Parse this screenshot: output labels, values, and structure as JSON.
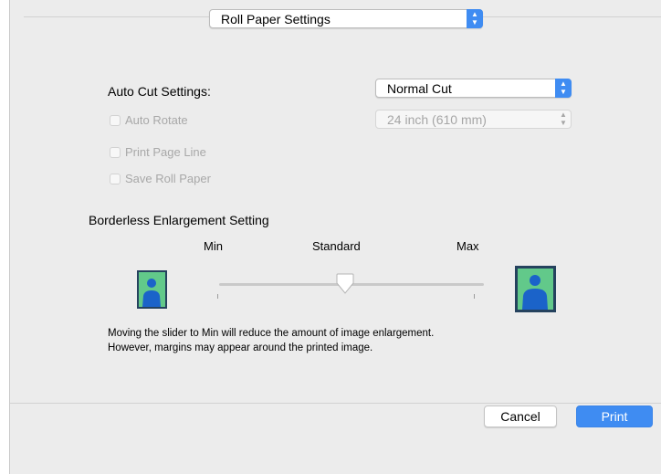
{
  "panel_select": {
    "value": "Roll Paper Settings"
  },
  "auto_cut": {
    "label": "Auto Cut Settings:",
    "value": "Normal Cut"
  },
  "roll_width": {
    "value": "24 inch (610 mm)"
  },
  "options": [
    {
      "label": "Auto Rotate",
      "checked": false,
      "enabled": false
    },
    {
      "label": "Print Page Line",
      "checked": false,
      "enabled": false
    },
    {
      "label": "Save Roll Paper",
      "checked": false,
      "enabled": false
    }
  ],
  "enlargement": {
    "heading": "Borderless Enlargement Setting",
    "min_label": "Min",
    "standard_label": "Standard",
    "max_label": "Max",
    "level": "Standard",
    "description_line1": "Moving the slider to Min will reduce the amount of image enlargement.",
    "description_line2": "However, margins may appear around the printed image."
  },
  "buttons": {
    "cancel": "Cancel",
    "print": "Print"
  },
  "colors": {
    "accent": "#3f8cf2",
    "icon_bg": "#62c98a",
    "icon_person": "#1b63c9"
  },
  "icons": [
    "person-small-icon",
    "person-large-icon",
    "popup-arrows-icon"
  ]
}
